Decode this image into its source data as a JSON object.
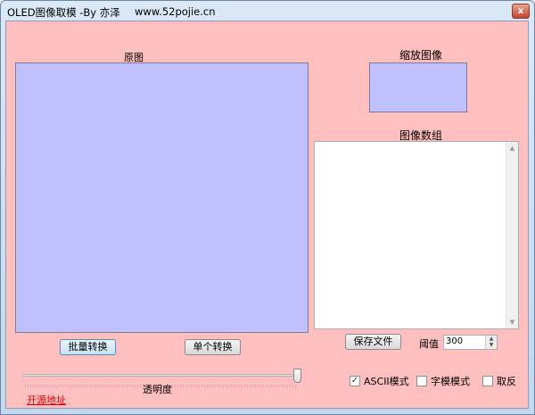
{
  "window": {
    "title": "OLED图像取模  -By 亦泽",
    "url": "www.52pojie.cn",
    "close": "x"
  },
  "labels": {
    "original": "原图",
    "scaled": "缩放图像",
    "array": "图像数组",
    "opacity": "透明度",
    "threshold": "阈值"
  },
  "buttons": {
    "batch": "批量转换",
    "single": "单个转换",
    "save": "保存文件"
  },
  "threshold_value": "300",
  "opacity_percent": 100,
  "checkboxes": [
    {
      "label": "ASCII模式",
      "checked": true
    },
    {
      "label": "字模模式",
      "checked": false
    },
    {
      "label": "取反",
      "checked": false
    }
  ],
  "link": "开源地址",
  "colors": {
    "background": "#ffbfbf",
    "image": "#c0c0ff",
    "link": "#e00000"
  }
}
